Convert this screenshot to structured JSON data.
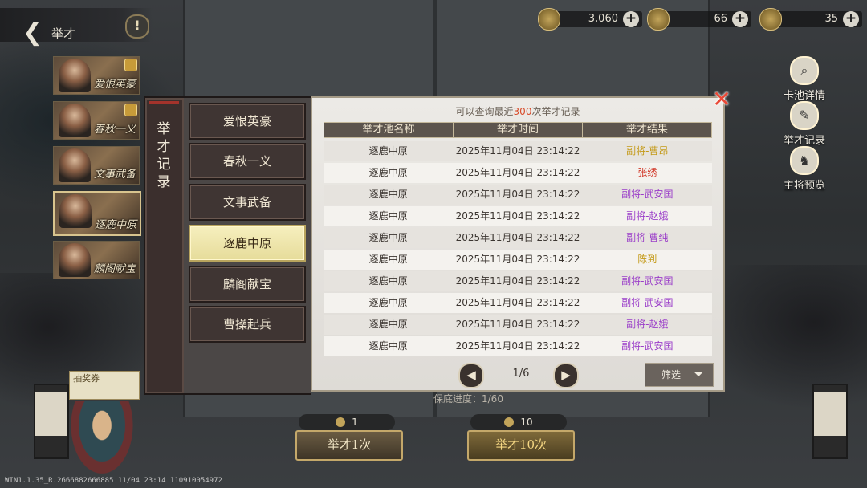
{
  "header": {
    "title": "举才",
    "info_icon": "!"
  },
  "resources": [
    {
      "icon": "coin-icon",
      "value": "3,060"
    },
    {
      "icon": "jade-icon",
      "value": "66"
    },
    {
      "icon": "token-icon",
      "value": "35"
    }
  ],
  "pool_list": [
    {
      "label": "爱恨英豪",
      "selected": false
    },
    {
      "label": "春秋一义",
      "selected": false
    },
    {
      "label": "文事武备",
      "selected": false
    },
    {
      "label": "逐鹿中原",
      "selected": true
    },
    {
      "label": "麟阁献宝",
      "selected": false
    }
  ],
  "side_buttons": [
    {
      "label": "卡池详情",
      "icon": "magnifier-icon"
    },
    {
      "label": "举才记录",
      "icon": "brush-icon"
    },
    {
      "label": "主将预览",
      "icon": "general-icon"
    }
  ],
  "modal": {
    "title": "举才记录",
    "tabs": [
      {
        "label": "爱恨英豪"
      },
      {
        "label": "春秋一义"
      },
      {
        "label": "文事武备"
      },
      {
        "label": "逐鹿中原",
        "selected": true
      },
      {
        "label": "麟阁献宝"
      },
      {
        "label": "曹操起兵"
      }
    ],
    "note_prefix": "可以查询最近",
    "note_count": "300",
    "note_suffix": "次举才记录",
    "columns": [
      "举才池名称",
      "举才时间",
      "举才结果"
    ],
    "rows": [
      {
        "pool": "逐鹿中原",
        "time": "2025年11月04日 23:14:22",
        "result": "副将-曹昂",
        "color": "#c49a18"
      },
      {
        "pool": "逐鹿中原",
        "time": "2025年11月04日 23:14:22",
        "result": "张绣",
        "color": "#d23a2a"
      },
      {
        "pool": "逐鹿中原",
        "time": "2025年11月04日 23:14:22",
        "result": "副将-武安国",
        "color": "#9b3fc9"
      },
      {
        "pool": "逐鹿中原",
        "time": "2025年11月04日 23:14:22",
        "result": "副将-赵娥",
        "color": "#9b3fc9"
      },
      {
        "pool": "逐鹿中原",
        "time": "2025年11月04日 23:14:22",
        "result": "副将-曹纯",
        "color": "#9b3fc9"
      },
      {
        "pool": "逐鹿中原",
        "time": "2025年11月04日 23:14:22",
        "result": "陈到",
        "color": "#c49a18"
      },
      {
        "pool": "逐鹿中原",
        "time": "2025年11月04日 23:14:22",
        "result": "副将-武安国",
        "color": "#9b3fc9"
      },
      {
        "pool": "逐鹿中原",
        "time": "2025年11月04日 23:14:22",
        "result": "副将-武安国",
        "color": "#9b3fc9"
      },
      {
        "pool": "逐鹿中原",
        "time": "2025年11月04日 23:14:22",
        "result": "副将-赵娥",
        "color": "#9b3fc9"
      },
      {
        "pool": "逐鹿中原",
        "time": "2025年11月04日 23:14:22",
        "result": "副将-武安国",
        "color": "#9b3fc9"
      }
    ],
    "pager": {
      "current": "1/6"
    },
    "filter_label": "筛选"
  },
  "guarantee_text": "保底进度：1/60",
  "draw_buttons": [
    {
      "cost": "1",
      "label": "举才1次"
    },
    {
      "cost": "10",
      "label": "举才10次"
    }
  ],
  "ticket_text": "抽奖券",
  "version_text": "WIN1.1.35_R.2666882666885 11/04 23:14 110910054972"
}
